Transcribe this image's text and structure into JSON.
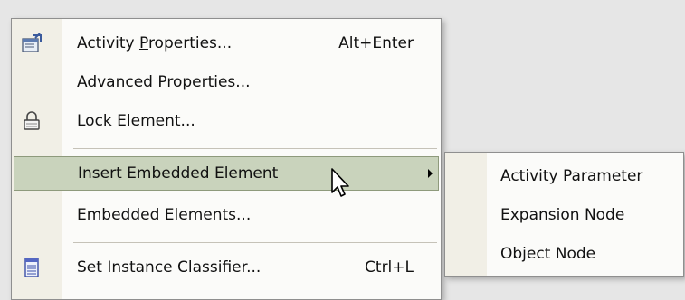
{
  "main_menu": {
    "items": [
      {
        "label": "Activity Properties...",
        "mnemonic_prefix": "Activity ",
        "mnemonic_letter": "P",
        "mnemonic_rest": "roperties...",
        "shortcut": "Alt+Enter",
        "icon": "properties-icon"
      },
      {
        "label": "Advanced Properties...",
        "shortcut": ""
      },
      {
        "label": "Lock Element...",
        "shortcut": "",
        "icon": "lock-icon"
      },
      {
        "label": "Insert Embedded Element",
        "shortcut": "",
        "submenu": true,
        "highlighted": true
      },
      {
        "label": "Embedded Elements...",
        "shortcut": ""
      },
      {
        "label": "Set Instance Classifier...",
        "shortcut": "Ctrl+L",
        "icon": "classifier-icon"
      }
    ]
  },
  "submenu": {
    "items": [
      {
        "label": "Activity Parameter"
      },
      {
        "label": "Expansion Node"
      },
      {
        "label": "Object Node"
      }
    ]
  },
  "colors": {
    "menu_bg": "#fbfbf9",
    "gutter": "#f1efe6",
    "highlight": "#c9d3bc",
    "highlight_border": "#8e9a7c"
  }
}
